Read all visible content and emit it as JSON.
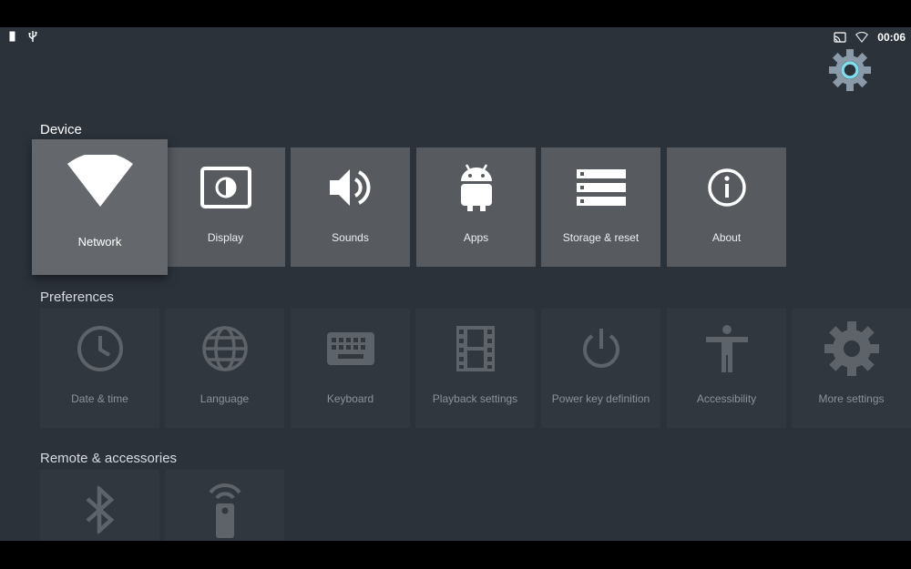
{
  "status_bar": {
    "time": "00:06",
    "left_icons": [
      "sd-card-icon",
      "usb-icon"
    ],
    "right_icons": [
      "cast-icon",
      "wifi-icon"
    ]
  },
  "header": {
    "settings_icon": "gear-icon"
  },
  "sections": {
    "device": {
      "title": "Device",
      "items": [
        {
          "label": "Network",
          "icon": "wifi-icon",
          "focused": true
        },
        {
          "label": "Display",
          "icon": "display-icon"
        },
        {
          "label": "Sounds",
          "icon": "speaker-icon"
        },
        {
          "label": "Apps",
          "icon": "android-icon"
        },
        {
          "label": "Storage & reset",
          "icon": "storage-icon"
        },
        {
          "label": "About",
          "icon": "info-icon"
        }
      ]
    },
    "preferences": {
      "title": "Preferences",
      "items": [
        {
          "label": "Date & time",
          "icon": "clock-icon"
        },
        {
          "label": "Language",
          "icon": "globe-icon"
        },
        {
          "label": "Keyboard",
          "icon": "keyboard-icon"
        },
        {
          "label": "Playback settings",
          "icon": "film-icon"
        },
        {
          "label": "Power key definition",
          "icon": "power-icon"
        },
        {
          "label": "Accessibility",
          "icon": "accessibility-icon"
        },
        {
          "label": "More settings",
          "icon": "gear-icon"
        }
      ]
    },
    "remote": {
      "title": "Remote & accessories",
      "items": [
        {
          "icon": "bluetooth-icon"
        },
        {
          "icon": "remote-icon"
        }
      ]
    }
  },
  "colors": {
    "background": "#2b323a",
    "tile": "#575b60",
    "tile_focused": "#64686d",
    "tile_dim": "#31373e",
    "accent": "#80deea"
  }
}
